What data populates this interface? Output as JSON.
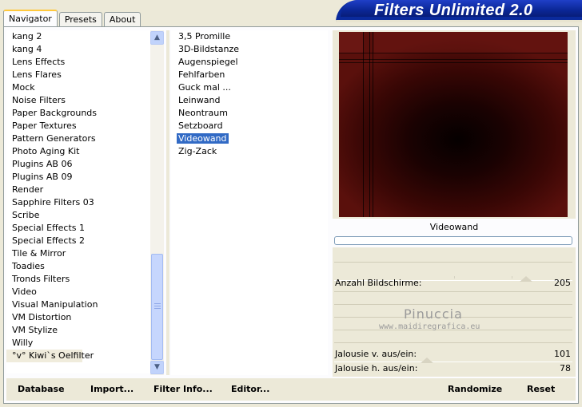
{
  "tabs": [
    {
      "label": "Navigator"
    },
    {
      "label": "Presets"
    },
    {
      "label": "About"
    }
  ],
  "app_title": "Filters Unlimited 2.0",
  "categories": [
    "kang 2",
    "kang 4",
    "Lens Effects",
    "Lens Flares",
    "Mock",
    "Noise Filters",
    "Paper Backgrounds",
    "Paper Textures",
    "Pattern Generators",
    "Photo Aging Kit",
    "Plugins AB 06",
    "Plugins AB 09",
    "Render",
    "Sapphire Filters 03",
    "Scribe",
    "Special Effects 1",
    "Special Effects 2",
    "Tile & Mirror",
    "Toadies",
    "Tronds Filters",
    "Video",
    "Visual Manipulation",
    "VM Distortion",
    "VM Stylize",
    "Willy",
    "°v° Kiwi`s Oelfilter"
  ],
  "selected_category": "°v° Kiwi`s Oelfilter",
  "filters": [
    "3,5 Promille",
    "3D-Bildstanze",
    "Augenspiegel",
    "Fehlfarben",
    "Guck mal ...",
    "Leinwand",
    "Neontraum",
    "Setzboard",
    "Videowand",
    "Zig-Zack"
  ],
  "selected_filter": "Videowand",
  "preview_label": "Videowand",
  "params": {
    "anzahl": {
      "label": "Anzahl Bildschirme:",
      "value": "205"
    },
    "jalousie_v": {
      "label": "Jalousie v. aus/ein:",
      "value": "101"
    },
    "jalousie_h": {
      "label": "Jalousie h. aus/ein:",
      "value": "78"
    }
  },
  "watermark": {
    "line1": "Pinuccia",
    "line2": "www.maidiregrafica.eu"
  },
  "buttons": {
    "database": "Database",
    "import": "Import...",
    "filter_info": "Filter Info...",
    "editor": "Editor...",
    "randomize": "Randomize",
    "reset": "Reset"
  },
  "colors": {
    "selection": "#316ac5",
    "banner": "#0b2797",
    "dialog_bg": "#ece9d8"
  },
  "icons": {
    "scroll_up": "scroll-up-arrow-icon",
    "scroll_down": "scroll-down-arrow-icon"
  }
}
